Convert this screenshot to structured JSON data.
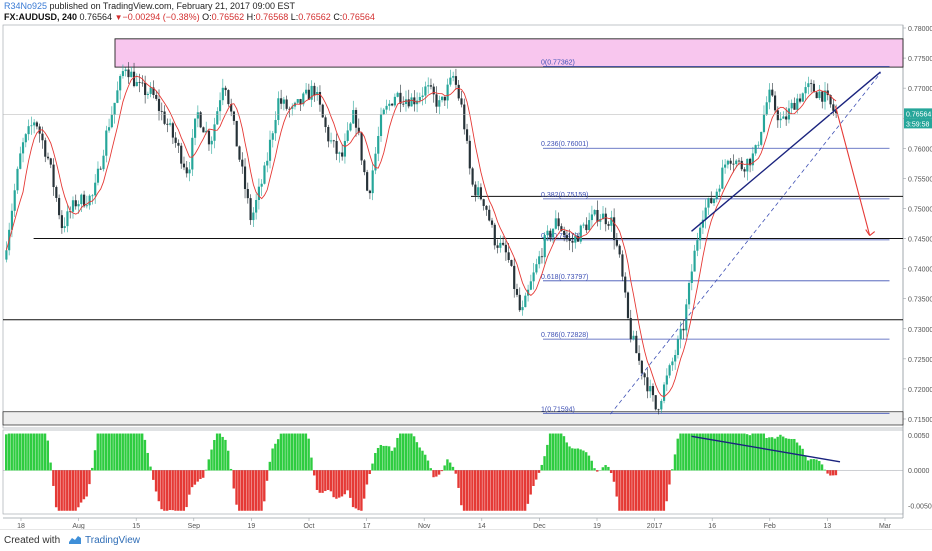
{
  "header": {
    "line1_author": "R34No925",
    "line1_rest": " published on TradingView.com, February 21, 2017 09:00 EST",
    "symbol": "FX:AUDUSD, 240",
    "last": "0.76564",
    "change": "−0.00294 (−0.38%)",
    "open_label": "O:",
    "open": "0.76562",
    "high_label": "H:",
    "high": "0.76568",
    "low_label": "L:",
    "low": "0.76562",
    "close_label": "C:",
    "close": "0.76564"
  },
  "footer": {
    "created_with": "Created with",
    "brand": "TradingView"
  },
  "chart_data": {
    "type": "candlestick",
    "instrument": "FX:AUDUSD",
    "timeframe": "240",
    "x_labels": [
      "18",
      "Aug",
      "15",
      "Sep",
      "19",
      "Oct",
      "17",
      "Nov",
      "14",
      "Dec",
      "19",
      "2017",
      "16",
      "Feb",
      "13",
      "Mar"
    ],
    "y_ticks": [
      "0.78000",
      "0.77500",
      "0.77000",
      "0.76500",
      "0.76000",
      "0.75500",
      "0.75000",
      "0.74500",
      "0.74000",
      "0.73500",
      "0.73000",
      "0.72500",
      "0.72000",
      "0.71500"
    ],
    "y_range": [
      0.7135,
      0.7805
    ],
    "price_label": "0.76564",
    "countdown_label": "3:59:58",
    "approx_price_path": [
      [
        0,
        0.7415
      ],
      [
        0.02,
        0.76
      ],
      [
        0.035,
        0.765
      ],
      [
        0.05,
        0.758
      ],
      [
        0.065,
        0.747
      ],
      [
        0.08,
        0.751
      ],
      [
        0.1,
        0.752
      ],
      [
        0.115,
        0.763
      ],
      [
        0.135,
        0.774
      ],
      [
        0.15,
        0.77
      ],
      [
        0.165,
        0.769
      ],
      [
        0.185,
        0.763
      ],
      [
        0.205,
        0.756
      ],
      [
        0.215,
        0.766
      ],
      [
        0.23,
        0.761
      ],
      [
        0.245,
        0.772
      ],
      [
        0.26,
        0.76
      ],
      [
        0.275,
        0.748
      ],
      [
        0.29,
        0.756
      ],
      [
        0.305,
        0.768
      ],
      [
        0.32,
        0.766
      ],
      [
        0.345,
        0.77
      ],
      [
        0.36,
        0.762
      ],
      [
        0.375,
        0.758
      ],
      [
        0.39,
        0.766
      ],
      [
        0.405,
        0.752
      ],
      [
        0.42,
        0.765
      ],
      [
        0.435,
        0.769
      ],
      [
        0.455,
        0.768
      ],
      [
        0.47,
        0.77
      ],
      [
        0.485,
        0.767
      ],
      [
        0.5,
        0.772
      ],
      [
        0.51,
        0.766
      ],
      [
        0.52,
        0.754
      ],
      [
        0.535,
        0.751
      ],
      [
        0.545,
        0.745
      ],
      [
        0.56,
        0.742
      ],
      [
        0.575,
        0.732
      ],
      [
        0.585,
        0.737
      ],
      [
        0.6,
        0.744
      ],
      [
        0.615,
        0.748
      ],
      [
        0.63,
        0.744
      ],
      [
        0.645,
        0.747
      ],
      [
        0.66,
        0.749
      ],
      [
        0.675,
        0.748
      ],
      [
        0.685,
        0.741
      ],
      [
        0.695,
        0.73
      ],
      [
        0.705,
        0.725
      ],
      [
        0.715,
        0.721
      ],
      [
        0.725,
        0.7165
      ],
      [
        0.74,
        0.723
      ],
      [
        0.755,
        0.73
      ],
      [
        0.765,
        0.74
      ],
      [
        0.775,
        0.749
      ],
      [
        0.79,
        0.752
      ],
      [
        0.805,
        0.759
      ],
      [
        0.82,
        0.757
      ],
      [
        0.835,
        0.759
      ],
      [
        0.85,
        0.769
      ],
      [
        0.865,
        0.764
      ],
      [
        0.88,
        0.768
      ],
      [
        0.895,
        0.77
      ],
      [
        0.91,
        0.769
      ],
      [
        0.925,
        0.7656
      ]
    ],
    "fib_levels": [
      {
        "label": "0(0.77362)",
        "value": 0.77362
      },
      {
        "label": "0.236(0.76001)",
        "value": 0.76001
      },
      {
        "label": "0.382(0.75159)",
        "value": 0.75159
      },
      {
        "label": "0.5(0.74478)",
        "value": 0.74478
      },
      {
        "label": "0.618(0.73797)",
        "value": 0.73797
      },
      {
        "label": "0.786(0.72828)",
        "value": 0.72828
      },
      {
        "label": "1(0.71594)",
        "value": 0.71594
      }
    ],
    "horizontal_levels": [
      0.752,
      0.745,
      0.7315
    ],
    "resistance_zone": [
      0.7735,
      0.7782
    ],
    "support_zone": [
      0.714,
      0.7162
    ],
    "oscillator": {
      "y_ticks": [
        "0.0050",
        "0.0000",
        "-0.0050"
      ],
      "y_range": [
        -0.0062,
        0.0057
      ]
    },
    "colors": {
      "candle_up": "#26a69a",
      "candle_down": "#263238",
      "moving_average": "#e53935",
      "fib_line": "#3f51b5",
      "trendline": "#1a237e",
      "arrow": "#e53935",
      "zone_fill": "#f8c6ee",
      "osc_pos": "#2ecc40",
      "osc_neg": "#e53935",
      "price_tag": "#26a69a"
    }
  }
}
